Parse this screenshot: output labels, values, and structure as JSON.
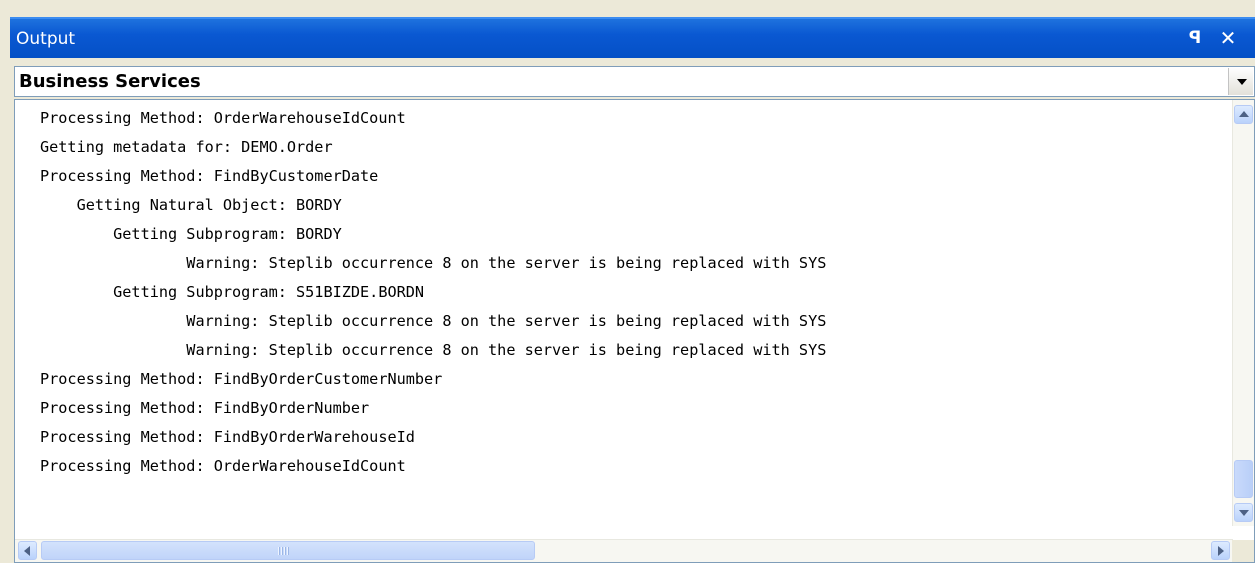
{
  "window": {
    "title": "Output"
  },
  "titlebar": {
    "pin_glyph": "ꟼ",
    "close_glyph": "✕"
  },
  "combo": {
    "selected": "Business Services"
  },
  "output": {
    "lines": [
      "Processing Method: OrderWarehouseIdCount",
      "Getting metadata for: DEMO.Order",
      "Processing Method: FindByCustomerDate",
      "    Getting Natural Object: BORDY",
      "        Getting Subprogram: BORDY",
      "                Warning: Steplib occurrence 8 on the server is being replaced with SYS",
      "        Getting Subprogram: S51BIZDE.BORDN",
      "                Warning: Steplib occurrence 8 on the server is being replaced with SYS",
      "                Warning: Steplib occurrence 8 on the server is being replaced with SYS",
      "Processing Method: FindByOrderCustomerNumber",
      "Processing Method: FindByOrderNumber",
      "Processing Method: FindByOrderWarehouseId",
      "Processing Method: OrderWarehouseIdCount"
    ]
  },
  "icons": {
    "pin": "pin-icon",
    "close": "close-icon",
    "dropdown": "chevron-down-icon",
    "scroll_up": "arrow-up-icon",
    "scroll_down": "arrow-down-icon",
    "scroll_left": "arrow-left-icon",
    "scroll_right": "arrow-right-icon"
  },
  "colors": {
    "titlebar": "#0a58d2",
    "panel_bg": "#ece9d8",
    "border": "#7f9db9"
  }
}
